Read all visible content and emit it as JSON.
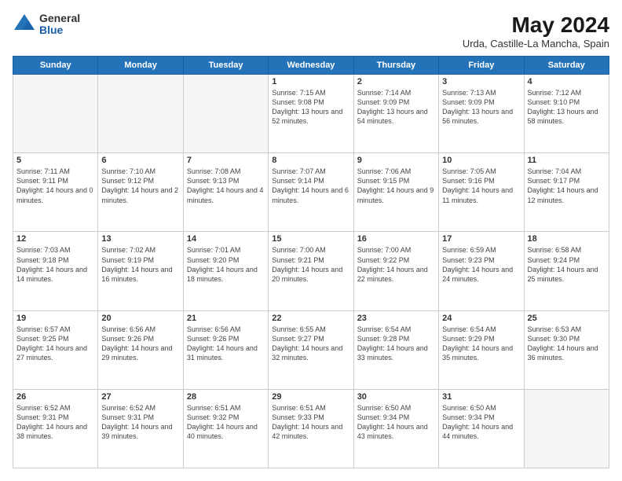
{
  "logo": {
    "general": "General",
    "blue": "Blue"
  },
  "title": "May 2024",
  "subtitle": "Urda, Castille-La Mancha, Spain",
  "weekdays": [
    "Sunday",
    "Monday",
    "Tuesday",
    "Wednesday",
    "Thursday",
    "Friday",
    "Saturday"
  ],
  "weeks": [
    [
      {
        "day": "",
        "info": ""
      },
      {
        "day": "",
        "info": ""
      },
      {
        "day": "",
        "info": ""
      },
      {
        "day": "1",
        "info": "Sunrise: 7:15 AM\nSunset: 9:08 PM\nDaylight: 13 hours and 52 minutes."
      },
      {
        "day": "2",
        "info": "Sunrise: 7:14 AM\nSunset: 9:09 PM\nDaylight: 13 hours and 54 minutes."
      },
      {
        "day": "3",
        "info": "Sunrise: 7:13 AM\nSunset: 9:09 PM\nDaylight: 13 hours and 56 minutes."
      },
      {
        "day": "4",
        "info": "Sunrise: 7:12 AM\nSunset: 9:10 PM\nDaylight: 13 hours and 58 minutes."
      }
    ],
    [
      {
        "day": "5",
        "info": "Sunrise: 7:11 AM\nSunset: 9:11 PM\nDaylight: 14 hours and 0 minutes."
      },
      {
        "day": "6",
        "info": "Sunrise: 7:10 AM\nSunset: 9:12 PM\nDaylight: 14 hours and 2 minutes."
      },
      {
        "day": "7",
        "info": "Sunrise: 7:08 AM\nSunset: 9:13 PM\nDaylight: 14 hours and 4 minutes."
      },
      {
        "day": "8",
        "info": "Sunrise: 7:07 AM\nSunset: 9:14 PM\nDaylight: 14 hours and 6 minutes."
      },
      {
        "day": "9",
        "info": "Sunrise: 7:06 AM\nSunset: 9:15 PM\nDaylight: 14 hours and 9 minutes."
      },
      {
        "day": "10",
        "info": "Sunrise: 7:05 AM\nSunset: 9:16 PM\nDaylight: 14 hours and 11 minutes."
      },
      {
        "day": "11",
        "info": "Sunrise: 7:04 AM\nSunset: 9:17 PM\nDaylight: 14 hours and 12 minutes."
      }
    ],
    [
      {
        "day": "12",
        "info": "Sunrise: 7:03 AM\nSunset: 9:18 PM\nDaylight: 14 hours and 14 minutes."
      },
      {
        "day": "13",
        "info": "Sunrise: 7:02 AM\nSunset: 9:19 PM\nDaylight: 14 hours and 16 minutes."
      },
      {
        "day": "14",
        "info": "Sunrise: 7:01 AM\nSunset: 9:20 PM\nDaylight: 14 hours and 18 minutes."
      },
      {
        "day": "15",
        "info": "Sunrise: 7:00 AM\nSunset: 9:21 PM\nDaylight: 14 hours and 20 minutes."
      },
      {
        "day": "16",
        "info": "Sunrise: 7:00 AM\nSunset: 9:22 PM\nDaylight: 14 hours and 22 minutes."
      },
      {
        "day": "17",
        "info": "Sunrise: 6:59 AM\nSunset: 9:23 PM\nDaylight: 14 hours and 24 minutes."
      },
      {
        "day": "18",
        "info": "Sunrise: 6:58 AM\nSunset: 9:24 PM\nDaylight: 14 hours and 25 minutes."
      }
    ],
    [
      {
        "day": "19",
        "info": "Sunrise: 6:57 AM\nSunset: 9:25 PM\nDaylight: 14 hours and 27 minutes."
      },
      {
        "day": "20",
        "info": "Sunrise: 6:56 AM\nSunset: 9:26 PM\nDaylight: 14 hours and 29 minutes."
      },
      {
        "day": "21",
        "info": "Sunrise: 6:56 AM\nSunset: 9:26 PM\nDaylight: 14 hours and 31 minutes."
      },
      {
        "day": "22",
        "info": "Sunrise: 6:55 AM\nSunset: 9:27 PM\nDaylight: 14 hours and 32 minutes."
      },
      {
        "day": "23",
        "info": "Sunrise: 6:54 AM\nSunset: 9:28 PM\nDaylight: 14 hours and 33 minutes."
      },
      {
        "day": "24",
        "info": "Sunrise: 6:54 AM\nSunset: 9:29 PM\nDaylight: 14 hours and 35 minutes."
      },
      {
        "day": "25",
        "info": "Sunrise: 6:53 AM\nSunset: 9:30 PM\nDaylight: 14 hours and 36 minutes."
      }
    ],
    [
      {
        "day": "26",
        "info": "Sunrise: 6:52 AM\nSunset: 9:31 PM\nDaylight: 14 hours and 38 minutes."
      },
      {
        "day": "27",
        "info": "Sunrise: 6:52 AM\nSunset: 9:31 PM\nDaylight: 14 hours and 39 minutes."
      },
      {
        "day": "28",
        "info": "Sunrise: 6:51 AM\nSunset: 9:32 PM\nDaylight: 14 hours and 40 minutes."
      },
      {
        "day": "29",
        "info": "Sunrise: 6:51 AM\nSunset: 9:33 PM\nDaylight: 14 hours and 42 minutes."
      },
      {
        "day": "30",
        "info": "Sunrise: 6:50 AM\nSunset: 9:34 PM\nDaylight: 14 hours and 43 minutes."
      },
      {
        "day": "31",
        "info": "Sunrise: 6:50 AM\nSunset: 9:34 PM\nDaylight: 14 hours and 44 minutes."
      },
      {
        "day": "",
        "info": ""
      }
    ]
  ]
}
